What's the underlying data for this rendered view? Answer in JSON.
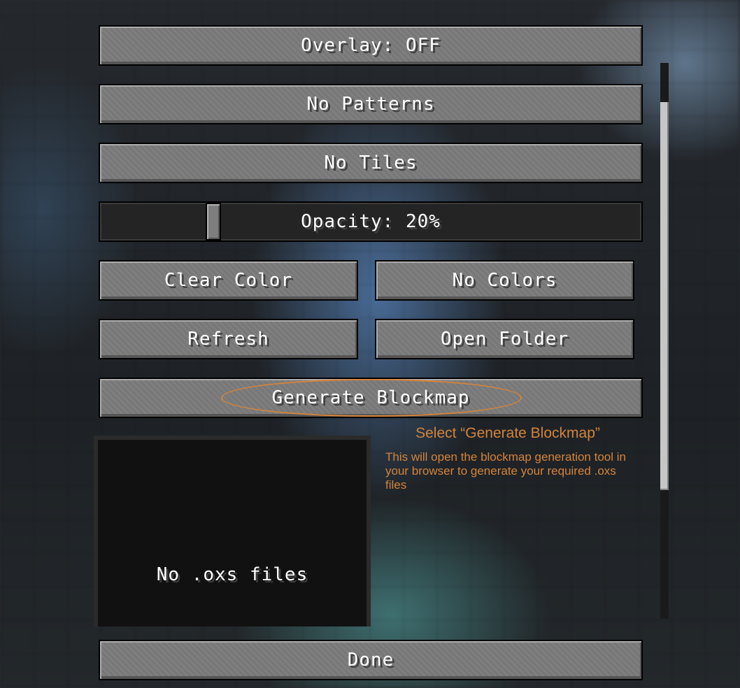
{
  "buttons": {
    "overlay": "Overlay: OFF",
    "patterns": "No Patterns",
    "tiles": "No Tiles",
    "clear_color": "Clear Color",
    "colors": "No Colors",
    "refresh": "Refresh",
    "open_folder": "Open Folder",
    "generate_blockmap": "Generate Blockmap",
    "done": "Done"
  },
  "opacity_slider": {
    "label": "Opacity: 20%",
    "value_percent": 20
  },
  "preview": {
    "empty_text": "No .oxs files"
  },
  "annotation": {
    "title": "Select “Generate Blockmap”",
    "description": "This will open the blockmap generation tool in your browser to generate your required .oxs files",
    "color": "#d5843b"
  }
}
